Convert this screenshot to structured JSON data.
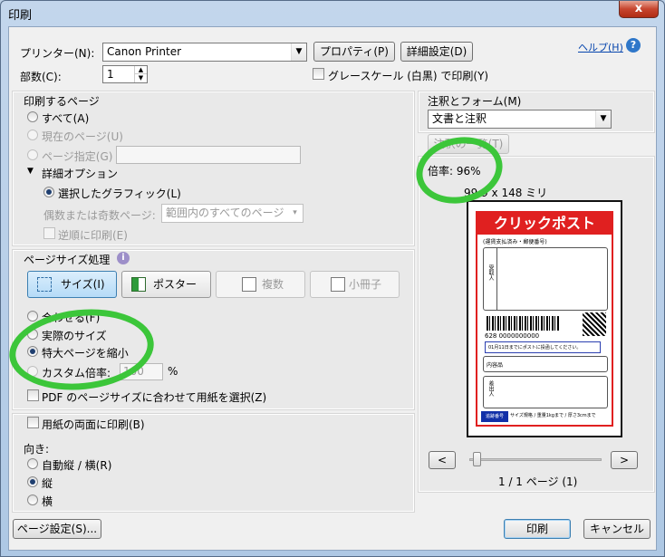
{
  "title": "印刷",
  "close_label": "x",
  "printer": {
    "label": "プリンター(N):",
    "value": "Canon  Printer",
    "properties": "プロパティ(P)",
    "advanced": "詳細設定(D)"
  },
  "help": "ヘルプ(H)",
  "copies": {
    "label": "部数(C):",
    "value": "1"
  },
  "grayscale": "グレースケール (白黒) で印刷(Y)",
  "pages": {
    "heading": "印刷するページ",
    "all": "すべて(A)",
    "current": "現在のページ(U)",
    "range": "ページ指定(G)",
    "more": "詳細オプション",
    "selected_graphic": "選択したグラフィック(L)",
    "odd_even_label": "偶数または奇数ページ:",
    "odd_even_value": "範囲内のすべてのページ",
    "reverse": "逆順に印刷(E)"
  },
  "sizing": {
    "heading": "ページサイズ処理",
    "size": "サイズ(I)",
    "poster": "ポスター",
    "multiple": "複数",
    "booklet": "小冊子",
    "fit": "合わせる(F)",
    "actual": "実際のサイズ",
    "shrink": "特大ページを縮小",
    "custom": "カスタム倍率:",
    "custom_value": "100",
    "percent": "%",
    "pdf_size": "PDF のページサイズに合わせて用紙を選択(Z)"
  },
  "duplex": "用紙の両面に印刷(B)",
  "orientation": {
    "heading": "向き:",
    "auto": "自動縦 / 横(R)",
    "portrait": "縦",
    "landscape": "横"
  },
  "comments": {
    "heading": "注釈とフォーム(M)",
    "value": "文書と注釈",
    "summarize": "注釈の一覧(T)"
  },
  "scale": "倍率: 96%",
  "paper_size": "99.9 x 148 ミリ",
  "preview": {
    "brand": "クリックポスト",
    "paid": "(運賃支払済み・郵便番号)",
    "to": "受取人",
    "tracking": "628 0000000000",
    "notice": "01月11日までにポストに投函してください。",
    "sender": "内容品",
    "from": "差出人",
    "stamp": "追跡番号",
    "footer": "サイズ規格 / 重量1kgまで / 厚さ3cmまで"
  },
  "nav": {
    "prev": "<",
    "next": ">",
    "page": "1 / 1 ページ (1)"
  },
  "page_setup": "ページ設定(S)...",
  "print": "印刷",
  "cancel": "キャンセル"
}
